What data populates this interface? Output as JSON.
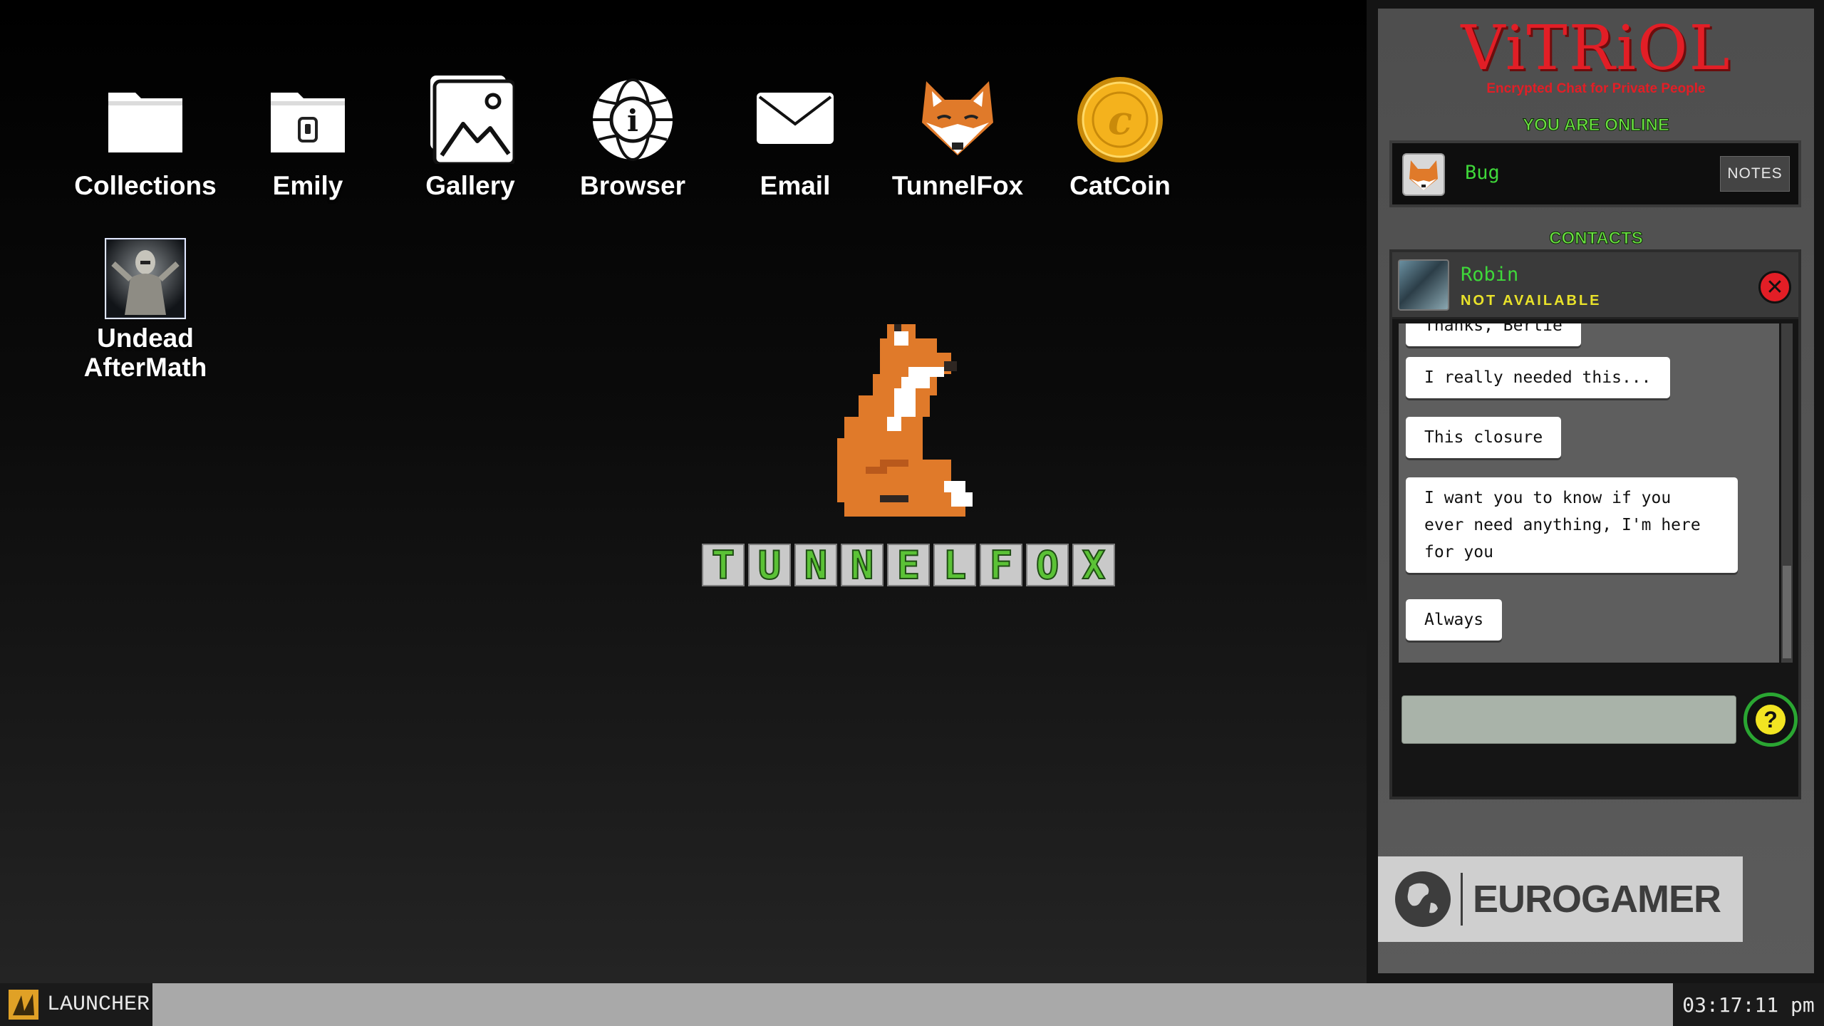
{
  "desktop": {
    "icons": [
      {
        "label": "Collections",
        "icon": "folder-icon"
      },
      {
        "label": "Emily",
        "icon": "locked-folder-icon"
      },
      {
        "label": "Gallery",
        "icon": "gallery-icon"
      },
      {
        "label": "Browser",
        "icon": "globe-info-icon"
      },
      {
        "label": "Email",
        "icon": "envelope-icon"
      },
      {
        "label": "TunnelFox",
        "icon": "fox-icon"
      },
      {
        "label": "CatCoin",
        "icon": "coin-icon"
      }
    ],
    "game_icon": {
      "line1": "Undead",
      "line2": "AfterMath",
      "icon": "zombie-thumbnail-icon"
    },
    "logo": {
      "text": "TUNNELFOX",
      "letters": [
        "T",
        "U",
        "N",
        "N",
        "E",
        "L",
        "F",
        "O",
        "X"
      ]
    }
  },
  "chat": {
    "app_title": "ViTRiOL",
    "tagline": "Encrypted Chat for Private People",
    "status": "YOU ARE ONLINE",
    "me": {
      "name": "Bug",
      "notes_label": "NOTES"
    },
    "contacts_header": "CONTACTS",
    "contact": {
      "name": "Robin",
      "status": "NOT AVAILABLE",
      "close_icon": "close-x-icon"
    },
    "messages": [
      "Thanks, Bertie",
      "I really needed this...",
      "This closure",
      "I want you to know if you ever need anything, I'm here for you",
      "Always"
    ],
    "input": {
      "placeholder": ""
    },
    "help_label": "?"
  },
  "watermark": {
    "text": "EUROGAMER"
  },
  "taskbar": {
    "launcher_label": "LAUNCHER",
    "clock": "03:17:11 pm"
  },
  "colors": {
    "accent_red": "#e21e26",
    "online_green": "#6be042",
    "name_green": "#3fd83a",
    "status_yellow": "#e9e22a",
    "fox_orange": "#e07a2a"
  }
}
